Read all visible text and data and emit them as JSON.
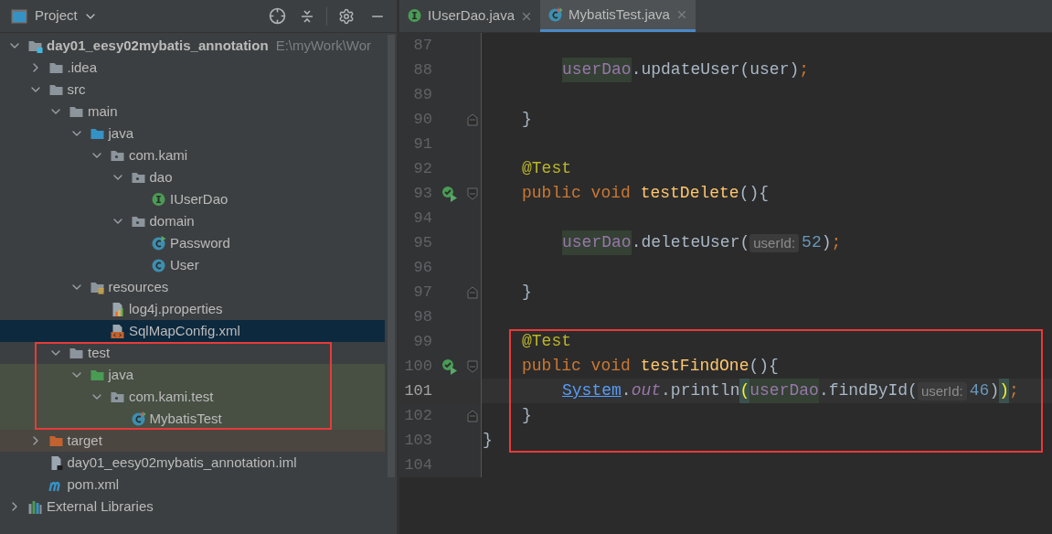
{
  "project_panel": {
    "title": "Project",
    "tree": [
      {
        "kind": "module",
        "label": "day01_eesy02mybatis_annotation",
        "path": "E:\\myWork\\Wor",
        "expanded": true,
        "selected": false,
        "children": [
          {
            "kind": "folder",
            "label": ".idea",
            "expanded": false,
            "selected": false
          },
          {
            "kind": "folder",
            "label": "src",
            "expanded": true,
            "selected": false,
            "children": [
              {
                "kind": "folder",
                "label": "main",
                "expanded": true,
                "selected": false,
                "children": [
                  {
                    "kind": "source-root",
                    "label": "java",
                    "expanded": true,
                    "selected": false,
                    "children": [
                      {
                        "kind": "package",
                        "label": "com.kami",
                        "expanded": true,
                        "selected": false,
                        "children": [
                          {
                            "kind": "package",
                            "label": "dao",
                            "expanded": true,
                            "selected": false,
                            "children": [
                              {
                                "kind": "interface",
                                "label": "IUserDao",
                                "selected": false
                              }
                            ]
                          },
                          {
                            "kind": "package",
                            "label": "domain",
                            "expanded": true,
                            "selected": false,
                            "children": [
                              {
                                "kind": "class-run",
                                "label": "Password",
                                "selected": false
                              },
                              {
                                "kind": "class",
                                "label": "User",
                                "selected": false
                              }
                            ]
                          }
                        ]
                      }
                    ]
                  },
                  {
                    "kind": "resources-root",
                    "label": "resources",
                    "expanded": true,
                    "selected": false,
                    "children": [
                      {
                        "kind": "properties",
                        "label": "log4j.properties",
                        "selected": false
                      },
                      {
                        "kind": "xml",
                        "label": "SqlMapConfig.xml",
                        "selected": true
                      }
                    ]
                  }
                ]
              },
              {
                "kind": "folder",
                "label": "test",
                "expanded": true,
                "selected": false,
                "highlighted": true,
                "children": [
                  {
                    "kind": "test-root",
                    "label": "java",
                    "expanded": true,
                    "selected": false,
                    "children": [
                      {
                        "kind": "package",
                        "label": "com.kami.test",
                        "expanded": true,
                        "selected": false,
                        "children": [
                          {
                            "kind": "class-test",
                            "label": "MybatisTest",
                            "selected": false
                          }
                        ]
                      }
                    ]
                  }
                ]
              }
            ]
          },
          {
            "kind": "excluded",
            "label": "target",
            "expanded": false,
            "selected": false
          },
          {
            "kind": "iml",
            "label": "day01_eesy02mybatis_annotation.iml",
            "selected": false
          },
          {
            "kind": "maven",
            "label": "pom.xml",
            "selected": false
          }
        ]
      },
      {
        "kind": "libraries",
        "label": "External Libraries",
        "expanded": false,
        "selected": false
      }
    ]
  },
  "editor": {
    "tabs": [
      {
        "kind": "interface",
        "label": "IUserDao.java",
        "selected": false
      },
      {
        "kind": "class-test",
        "label": "MybatisTest.java",
        "selected": true
      }
    ],
    "lines": [
      {
        "kind": "blank",
        "number": "87",
        "run": false,
        "current": false,
        "boxed": false,
        "fold_start": false,
        "fold_end": false
      },
      {
        "kind": "body",
        "number": "88",
        "run": false,
        "current": false,
        "boxed": false,
        "fold_start": false,
        "fold_end": false,
        "tokens": [
          {
            "kind": "field",
            "text": "userDao"
          },
          {
            "kind": "plain",
            "text": ".updateUser(user)"
          },
          {
            "kind": "punct",
            "text": ";"
          }
        ]
      },
      {
        "kind": "blank",
        "number": "89",
        "run": false,
        "current": false,
        "boxed": false,
        "fold_start": false,
        "fold_end": false
      },
      {
        "kind": "member",
        "number": "90",
        "run": false,
        "current": false,
        "boxed": false,
        "fold_start": false,
        "fold_end": true,
        "tokens": [
          {
            "kind": "plain",
            "text": "}"
          }
        ]
      },
      {
        "kind": "blank",
        "number": "91",
        "run": false,
        "current": false,
        "boxed": false,
        "fold_start": false,
        "fold_end": false
      },
      {
        "kind": "member",
        "number": "92",
        "run": false,
        "current": false,
        "boxed": false,
        "fold_start": false,
        "fold_end": false,
        "tokens": [
          {
            "kind": "annotation",
            "text": "@Test"
          }
        ]
      },
      {
        "kind": "member",
        "number": "93",
        "run": true,
        "current": false,
        "boxed": false,
        "fold_start": true,
        "fold_end": false,
        "tokens": [
          {
            "kind": "keyword",
            "text": "public void "
          },
          {
            "kind": "declaration",
            "text": "testDelete"
          },
          {
            "kind": "plain",
            "text": "(){"
          }
        ]
      },
      {
        "kind": "blank",
        "number": "94",
        "run": false,
        "current": false,
        "boxed": false,
        "fold_start": false,
        "fold_end": false
      },
      {
        "kind": "body",
        "number": "95",
        "run": false,
        "current": false,
        "boxed": false,
        "fold_start": false,
        "fold_end": false,
        "tokens": [
          {
            "kind": "field",
            "text": "userDao"
          },
          {
            "kind": "plain",
            "text": ".deleteUser("
          },
          {
            "kind": "hint",
            "text": "userId:"
          },
          {
            "kind": "number",
            "text": "52"
          },
          {
            "kind": "plain",
            "text": ")"
          },
          {
            "kind": "punct",
            "text": ";"
          }
        ]
      },
      {
        "kind": "blank",
        "number": "96",
        "run": false,
        "current": false,
        "boxed": false,
        "fold_start": false,
        "fold_end": false
      },
      {
        "kind": "member",
        "number": "97",
        "run": false,
        "current": false,
        "boxed": false,
        "fold_start": false,
        "fold_end": true,
        "tokens": [
          {
            "kind": "plain",
            "text": "}"
          }
        ]
      },
      {
        "kind": "blank",
        "number": "98",
        "run": false,
        "current": false,
        "boxed": false,
        "fold_start": false,
        "fold_end": false
      },
      {
        "kind": "member",
        "number": "99",
        "run": false,
        "current": false,
        "boxed": true,
        "fold_start": false,
        "fold_end": false,
        "tokens": [
          {
            "kind": "annotation",
            "text": "@Test"
          }
        ]
      },
      {
        "kind": "member",
        "number": "100",
        "run": true,
        "current": false,
        "boxed": true,
        "fold_start": true,
        "fold_end": false,
        "tokens": [
          {
            "kind": "keyword",
            "text": "public void "
          },
          {
            "kind": "declaration",
            "text": "testFindOne"
          },
          {
            "kind": "plain",
            "text": "(){"
          }
        ]
      },
      {
        "kind": "body",
        "number": "101",
        "run": false,
        "current": true,
        "boxed": true,
        "fold_start": false,
        "fold_end": false,
        "tokens": [
          {
            "kind": "class-link",
            "text": "System"
          },
          {
            "kind": "plain",
            "text": "."
          },
          {
            "kind": "static",
            "text": "out"
          },
          {
            "kind": "plain",
            "text": ".println"
          },
          {
            "kind": "paren-match",
            "text": "("
          },
          {
            "kind": "field",
            "text": "userDao"
          },
          {
            "kind": "plain",
            "text": ".findById("
          },
          {
            "kind": "hint",
            "text": "userId:"
          },
          {
            "kind": "number",
            "text": "46"
          },
          {
            "kind": "plain",
            "text": ")"
          },
          {
            "kind": "paren-match",
            "text": ")"
          },
          {
            "kind": "punct",
            "text": ";"
          }
        ]
      },
      {
        "kind": "member",
        "number": "102",
        "run": false,
        "current": false,
        "boxed": true,
        "fold_start": false,
        "fold_end": true,
        "tokens": [
          {
            "kind": "plain",
            "text": "}"
          }
        ]
      },
      {
        "kind": "top",
        "number": "103",
        "run": false,
        "current": false,
        "boxed": true,
        "fold_start": false,
        "fold_end": false,
        "tokens": [
          {
            "kind": "plain",
            "text": "}"
          }
        ]
      },
      {
        "kind": "blank",
        "number": "104",
        "run": false,
        "current": false,
        "boxed": false,
        "fold_start": false,
        "fold_end": false
      }
    ]
  }
}
